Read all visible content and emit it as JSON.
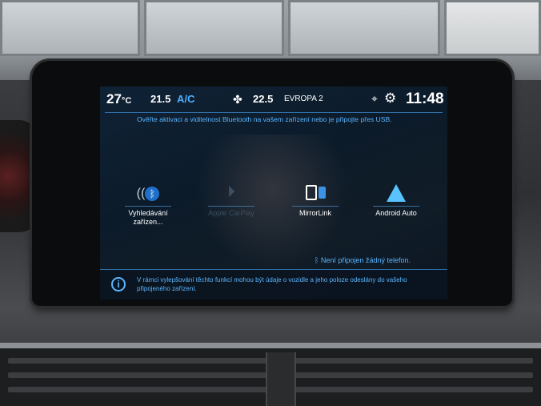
{
  "status_bar": {
    "outside_temp": "27",
    "outside_temp_unit": "°C",
    "cabin_temp_left": "21.5",
    "ac_label": "A/C",
    "fan_icon": "fan-icon",
    "cabin_temp_right": "22.5",
    "radio_station": "EVROPA 2",
    "clock": "11:48"
  },
  "message": "Ověřte aktivaci a viditelnost Bluetooth na vašem zařízení nebo je připojte přes USB.",
  "apps": [
    {
      "label": "Vyhledávání zařízen...",
      "icon": "bluetooth-icon",
      "enabled": true
    },
    {
      "label": "Apple CarPlay",
      "icon": "carplay-icon",
      "enabled": false
    },
    {
      "label": "MirrorLink",
      "icon": "mirrorlink-icon",
      "enabled": true
    },
    {
      "label": "Android Auto",
      "icon": "android-auto-icon",
      "enabled": true
    }
  ],
  "phone_status": "Není připojen žádný telefon.",
  "info_text": "V rámci vylepšování těchto funkcí mohou být údaje o vozidle a jeho poloze odeslány do vašeho připojeného zařízení.",
  "colors": {
    "accent": "#5ab5ff",
    "screen_bg": "#0c1b2a",
    "disabled": "#3c4e5f"
  }
}
